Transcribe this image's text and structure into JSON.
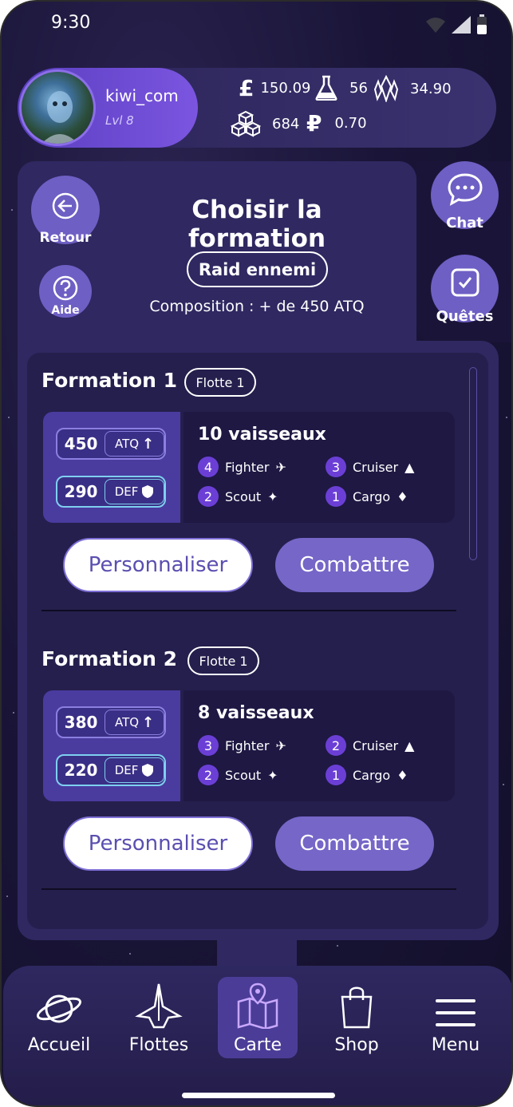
{
  "status": {
    "time": "9:30"
  },
  "profile": {
    "username": "kiwi_com",
    "level": "Lvl 8"
  },
  "currencies": {
    "pounds": "150.09",
    "flask": "56",
    "crystal": "34.90",
    "cubes": "684",
    "ruble": "0.70"
  },
  "header": {
    "title": "Choisir la formation",
    "back_label": "Retour",
    "help_label": "Aide",
    "chat_label": "Chat",
    "quests_label": "Quêtes",
    "raid_label": "Raid ennemi",
    "composition": "Composition : + de 450 ATQ"
  },
  "formations": [
    {
      "title": "Formation 1",
      "fleet": "Flotte 1",
      "atq": "450",
      "atq_label": "ATQ",
      "def": "290",
      "def_label": "DEF",
      "count": "10 vaisseaux",
      "ships": [
        {
          "n": "4",
          "name": "Fighter"
        },
        {
          "n": "3",
          "name": "Cruiser"
        },
        {
          "n": "2",
          "name": "Scout"
        },
        {
          "n": "1",
          "name": "Cargo"
        }
      ],
      "customize": "Personnaliser",
      "fight": "Combattre"
    },
    {
      "title": "Formation 2",
      "fleet": "Flotte 1",
      "atq": "380",
      "atq_label": "ATQ",
      "def": "220",
      "def_label": "DEF",
      "count": "8 vaisseaux",
      "ships": [
        {
          "n": "3",
          "name": "Fighter"
        },
        {
          "n": "2",
          "name": "Cruiser"
        },
        {
          "n": "2",
          "name": "Scout"
        },
        {
          "n": "1",
          "name": "Cargo"
        }
      ],
      "customize": "Personnaliser",
      "fight": "Combattre"
    }
  ],
  "nav": [
    {
      "label": "Accueil",
      "icon": "planet-icon"
    },
    {
      "label": "Flottes",
      "icon": "ship-icon"
    },
    {
      "label": "Carte",
      "icon": "map-icon"
    },
    {
      "label": "Shop",
      "icon": "bag-icon"
    },
    {
      "label": "Menu",
      "icon": "hamburger-icon"
    }
  ],
  "colors": {
    "accent": "#6e5fc4",
    "background": "#1a1538",
    "panel": "#2f2861"
  }
}
